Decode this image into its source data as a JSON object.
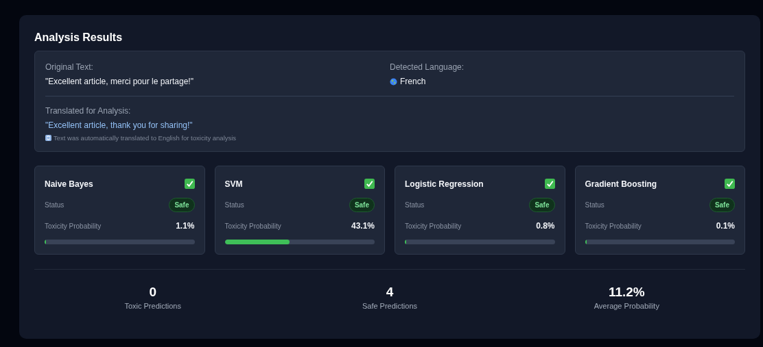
{
  "title": "Analysis Results",
  "original": {
    "label": "Original Text:",
    "text": "\"Excellent article, merci pour le partage!\""
  },
  "language": {
    "label": "Detected Language:",
    "value": "French"
  },
  "translation": {
    "label": "Translated for Analysis:",
    "text": "\"Excellent article, thank you for sharing!\"",
    "note": "Text was automatically translated to English for toxicity analysis"
  },
  "models": [
    {
      "name": "Naive Bayes",
      "toxic": false,
      "status_label": "Status",
      "status": "Safe",
      "prob_label": "Toxicity Probability",
      "prob": "1.1%",
      "level": 0.011
    },
    {
      "name": "SVM",
      "toxic": false,
      "status_label": "Status",
      "status": "Safe",
      "prob_label": "Toxicity Probability",
      "prob": "43.1%",
      "level": 0.431
    },
    {
      "name": "Logistic Regression",
      "toxic": false,
      "status_label": "Status",
      "status": "Safe",
      "prob_label": "Toxicity Probability",
      "prob": "0.8%",
      "level": 0.008
    },
    {
      "name": "Gradient Boosting",
      "toxic": false,
      "status_label": "Status",
      "status": "Safe",
      "prob_label": "Toxicity Probability",
      "prob": "0.1%",
      "level": 0.001
    }
  ],
  "summary": [
    {
      "value": "0",
      "label": "Toxic Predictions"
    },
    {
      "value": "4",
      "label": "Safe Predictions"
    },
    {
      "value": "11.2%",
      "label": "Average Probability"
    }
  ]
}
